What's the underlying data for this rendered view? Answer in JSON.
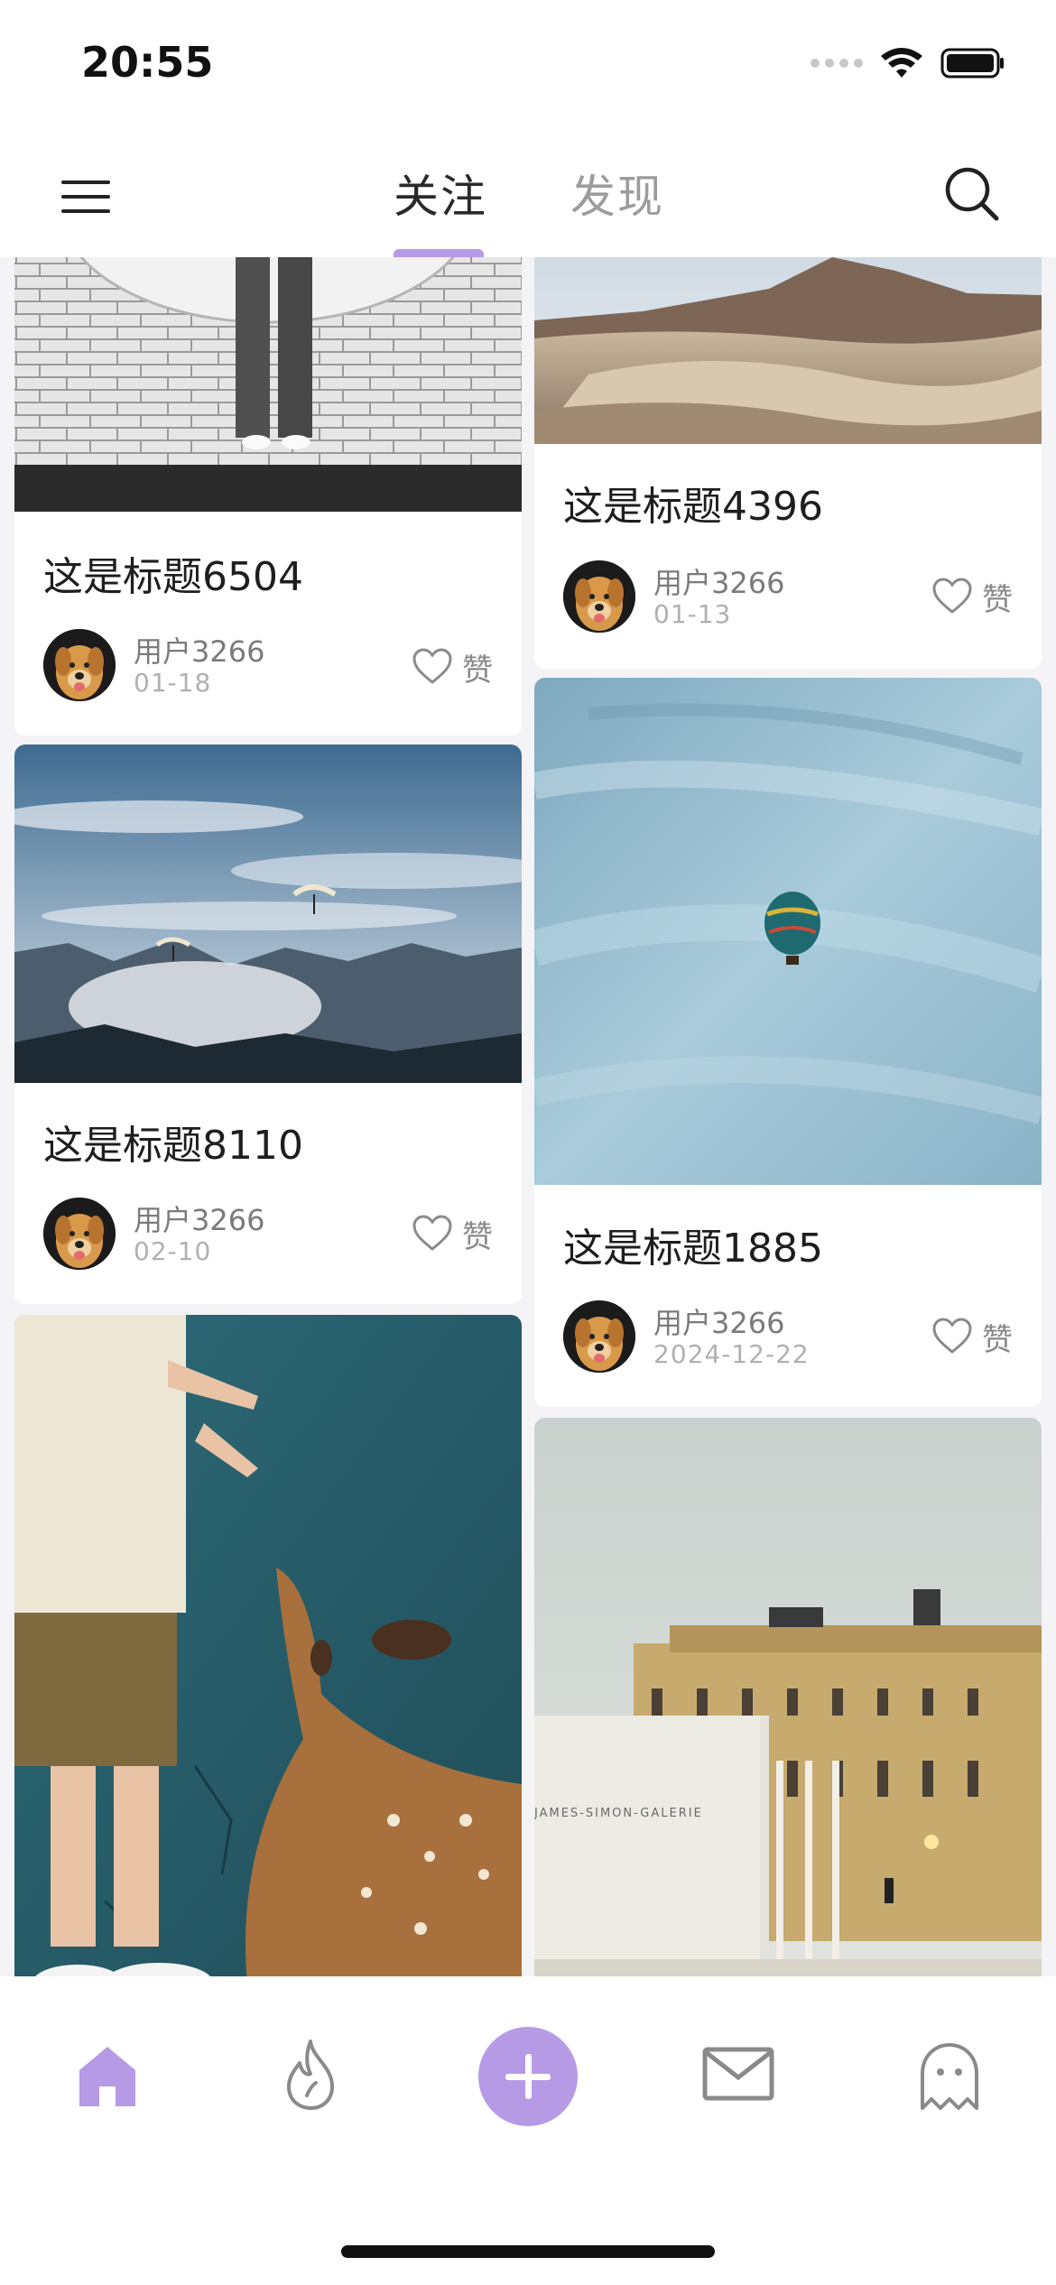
{
  "status_bar": {
    "time": "20:55"
  },
  "nav": {
    "tabs": [
      {
        "label": "关注",
        "active": true
      },
      {
        "label": "发现",
        "active": false
      }
    ],
    "accent_color": "#b79ae6"
  },
  "feed": {
    "like_label": "赞",
    "cards": [
      {
        "title": "这是标题6504",
        "user": "用户3266",
        "date": "01-18",
        "photo": "brick-wall-person"
      },
      {
        "title": "这是标题4396",
        "user": "用户3266",
        "date": "01-13",
        "photo": "desert-mountains"
      },
      {
        "title": "这是标题8110",
        "user": "用户3266",
        "date": "02-10",
        "photo": "paragliders-mountains"
      },
      {
        "title": "这是标题1885",
        "user": "用户3266",
        "date": "2024-12-22",
        "photo": "hot-air-balloon"
      },
      {
        "title": "",
        "user": "",
        "date": "",
        "photo": "person-feeding-deer"
      },
      {
        "title": "",
        "user": "",
        "date": "",
        "photo": "museum-building",
        "photo_text": "JAMES-SIMON-GALERIE"
      }
    ]
  },
  "tab_bar": {
    "items": [
      {
        "icon": "home-icon",
        "active": true
      },
      {
        "icon": "fire-icon",
        "active": false
      },
      {
        "icon": "plus-icon",
        "active": false
      },
      {
        "icon": "mail-icon",
        "active": false
      },
      {
        "icon": "ghost-icon",
        "active": false
      }
    ]
  }
}
